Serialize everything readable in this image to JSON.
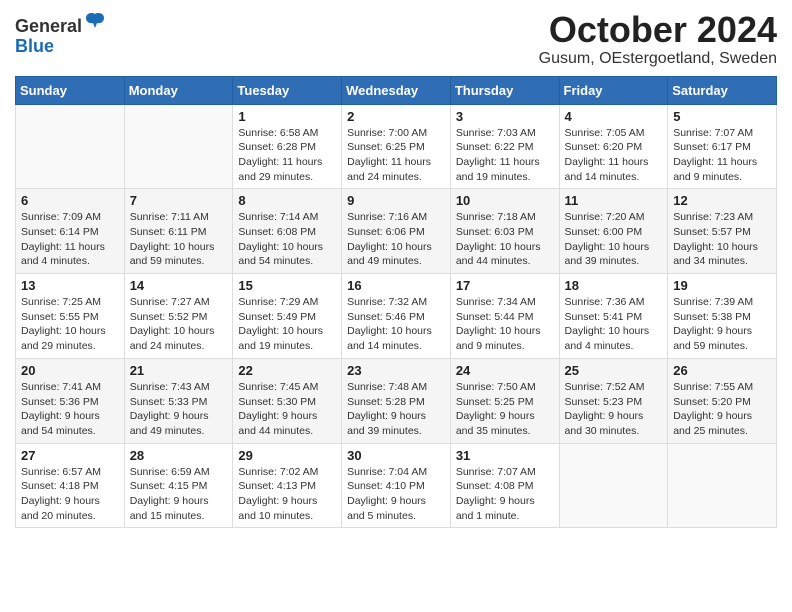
{
  "logo": {
    "general": "General",
    "blue": "Blue"
  },
  "title": "October 2024",
  "subtitle": "Gusum, OEstergoetland, Sweden",
  "headers": [
    "Sunday",
    "Monday",
    "Tuesday",
    "Wednesday",
    "Thursday",
    "Friday",
    "Saturday"
  ],
  "weeks": [
    [
      {
        "day": "",
        "info": ""
      },
      {
        "day": "",
        "info": ""
      },
      {
        "day": "1",
        "info": "Sunrise: 6:58 AM\nSunset: 6:28 PM\nDaylight: 11 hours and 29 minutes."
      },
      {
        "day": "2",
        "info": "Sunrise: 7:00 AM\nSunset: 6:25 PM\nDaylight: 11 hours and 24 minutes."
      },
      {
        "day": "3",
        "info": "Sunrise: 7:03 AM\nSunset: 6:22 PM\nDaylight: 11 hours and 19 minutes."
      },
      {
        "day": "4",
        "info": "Sunrise: 7:05 AM\nSunset: 6:20 PM\nDaylight: 11 hours and 14 minutes."
      },
      {
        "day": "5",
        "info": "Sunrise: 7:07 AM\nSunset: 6:17 PM\nDaylight: 11 hours and 9 minutes."
      }
    ],
    [
      {
        "day": "6",
        "info": "Sunrise: 7:09 AM\nSunset: 6:14 PM\nDaylight: 11 hours and 4 minutes."
      },
      {
        "day": "7",
        "info": "Sunrise: 7:11 AM\nSunset: 6:11 PM\nDaylight: 10 hours and 59 minutes."
      },
      {
        "day": "8",
        "info": "Sunrise: 7:14 AM\nSunset: 6:08 PM\nDaylight: 10 hours and 54 minutes."
      },
      {
        "day": "9",
        "info": "Sunrise: 7:16 AM\nSunset: 6:06 PM\nDaylight: 10 hours and 49 minutes."
      },
      {
        "day": "10",
        "info": "Sunrise: 7:18 AM\nSunset: 6:03 PM\nDaylight: 10 hours and 44 minutes."
      },
      {
        "day": "11",
        "info": "Sunrise: 7:20 AM\nSunset: 6:00 PM\nDaylight: 10 hours and 39 minutes."
      },
      {
        "day": "12",
        "info": "Sunrise: 7:23 AM\nSunset: 5:57 PM\nDaylight: 10 hours and 34 minutes."
      }
    ],
    [
      {
        "day": "13",
        "info": "Sunrise: 7:25 AM\nSunset: 5:55 PM\nDaylight: 10 hours and 29 minutes."
      },
      {
        "day": "14",
        "info": "Sunrise: 7:27 AM\nSunset: 5:52 PM\nDaylight: 10 hours and 24 minutes."
      },
      {
        "day": "15",
        "info": "Sunrise: 7:29 AM\nSunset: 5:49 PM\nDaylight: 10 hours and 19 minutes."
      },
      {
        "day": "16",
        "info": "Sunrise: 7:32 AM\nSunset: 5:46 PM\nDaylight: 10 hours and 14 minutes."
      },
      {
        "day": "17",
        "info": "Sunrise: 7:34 AM\nSunset: 5:44 PM\nDaylight: 10 hours and 9 minutes."
      },
      {
        "day": "18",
        "info": "Sunrise: 7:36 AM\nSunset: 5:41 PM\nDaylight: 10 hours and 4 minutes."
      },
      {
        "day": "19",
        "info": "Sunrise: 7:39 AM\nSunset: 5:38 PM\nDaylight: 9 hours and 59 minutes."
      }
    ],
    [
      {
        "day": "20",
        "info": "Sunrise: 7:41 AM\nSunset: 5:36 PM\nDaylight: 9 hours and 54 minutes."
      },
      {
        "day": "21",
        "info": "Sunrise: 7:43 AM\nSunset: 5:33 PM\nDaylight: 9 hours and 49 minutes."
      },
      {
        "day": "22",
        "info": "Sunrise: 7:45 AM\nSunset: 5:30 PM\nDaylight: 9 hours and 44 minutes."
      },
      {
        "day": "23",
        "info": "Sunrise: 7:48 AM\nSunset: 5:28 PM\nDaylight: 9 hours and 39 minutes."
      },
      {
        "day": "24",
        "info": "Sunrise: 7:50 AM\nSunset: 5:25 PM\nDaylight: 9 hours and 35 minutes."
      },
      {
        "day": "25",
        "info": "Sunrise: 7:52 AM\nSunset: 5:23 PM\nDaylight: 9 hours and 30 minutes."
      },
      {
        "day": "26",
        "info": "Sunrise: 7:55 AM\nSunset: 5:20 PM\nDaylight: 9 hours and 25 minutes."
      }
    ],
    [
      {
        "day": "27",
        "info": "Sunrise: 6:57 AM\nSunset: 4:18 PM\nDaylight: 9 hours and 20 minutes."
      },
      {
        "day": "28",
        "info": "Sunrise: 6:59 AM\nSunset: 4:15 PM\nDaylight: 9 hours and 15 minutes."
      },
      {
        "day": "29",
        "info": "Sunrise: 7:02 AM\nSunset: 4:13 PM\nDaylight: 9 hours and 10 minutes."
      },
      {
        "day": "30",
        "info": "Sunrise: 7:04 AM\nSunset: 4:10 PM\nDaylight: 9 hours and 5 minutes."
      },
      {
        "day": "31",
        "info": "Sunrise: 7:07 AM\nSunset: 4:08 PM\nDaylight: 9 hours and 1 minute."
      },
      {
        "day": "",
        "info": ""
      },
      {
        "day": "",
        "info": ""
      }
    ]
  ]
}
